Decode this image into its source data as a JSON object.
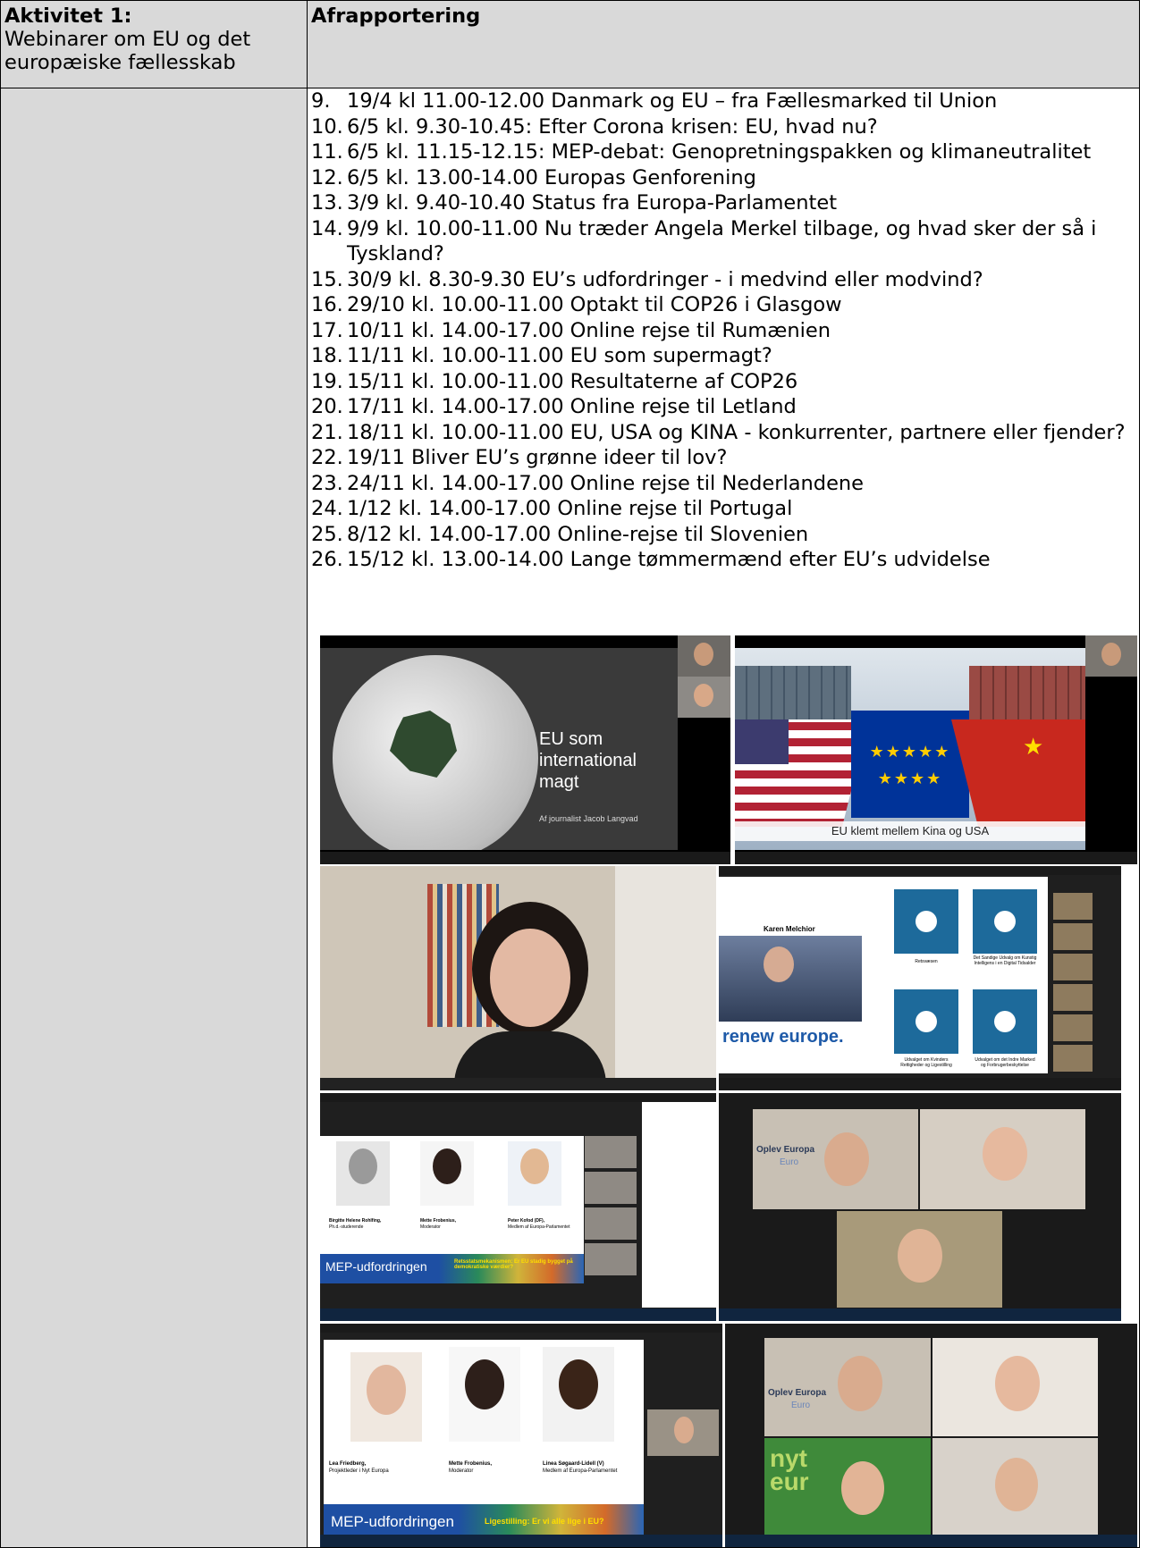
{
  "header": {
    "left_title": "Aktivitet 1:",
    "left_subtitle": "Webinarer om EU og det europæiske fællesskab",
    "right_title": "Afrapportering"
  },
  "events": [
    {
      "num": "9.",
      "text": "19/4 kl 11.00-12.00 Danmark og EU – fra Fællesmarked til Union"
    },
    {
      "num": "10.",
      "text": "6/5 kl. 9.30-10.45: Efter Corona krisen: EU, hvad nu?"
    },
    {
      "num": "11.",
      "text": "6/5 kl. 11.15-12.15: MEP-debat: Genopretningspakken og klimaneutralitet"
    },
    {
      "num": "12.",
      "text": "6/5 kl. 13.00-14.00 Europas Genforening"
    },
    {
      "num": "13.",
      "text": "3/9 kl. 9.40-10.40 Status fra Europa-Parlamentet"
    },
    {
      "num": "14.",
      "text": "9/9 kl. 10.00-11.00 Nu træder Angela Merkel tilbage, og hvad sker der så i Tyskland?"
    },
    {
      "num": "15.",
      "text": "30/9 kl. 8.30-9.30 EU’s udfordringer - i medvind eller modvind?"
    },
    {
      "num": "16.",
      "text": "29/10 kl. 10.00-11.00 Optakt til COP26 i Glasgow"
    },
    {
      "num": "17.",
      "text": "10/11 kl. 14.00-17.00 Online rejse til Rumænien"
    },
    {
      "num": "18.",
      "text": "11/11 kl. 10.00-11.00 EU som supermagt?"
    },
    {
      "num": "19.",
      "text": "15/11 kl. 10.00-11.00 Resultaterne af COP26"
    },
    {
      "num": "20.",
      "text": "17/11 kl. 14.00-17.00 Online rejse til Letland"
    },
    {
      "num": "21.",
      "text": "18/11 kl. 10.00-11.00 EU, USA og KINA - konkurrenter, partnere eller fjender?"
    },
    {
      "num": "22.",
      "text": "19/11 Bliver EU’s grønne ideer til lov?"
    },
    {
      "num": "23.",
      "text": "24/11 kl. 14.00-17.00 Online rejse til Nederlandene"
    },
    {
      "num": "24.",
      "text": "1/12 kl. 14.00-17.00 Online rejse til Portugal"
    },
    {
      "num": "25.",
      "text": "8/12 kl. 14.00-17.00 Online-rejse til Slovenien"
    },
    {
      "num": "26.",
      "text": "15/12 kl. 13.00-14.00 Lange tømmermænd efter EU’s udvidelse"
    }
  ],
  "screenshots": {
    "s1": {
      "title_l1": "EU som",
      "title_l2": "international",
      "title_l3": "magt",
      "byline": "Af journalist Jacob Langvad"
    },
    "s2": {
      "caption": "EU klemt mellem Kina og USA"
    },
    "s4": {
      "speaker": "Karen Melchior",
      "brand": "renew europe.",
      "box1": "Retsvæsen",
      "box2": "Det Sandige Udvalg om Kunstig Intelligens i en Digital Tidsalder",
      "box3": "Udvalget om Kvinders Rettigheder og Ligestilling",
      "box4": "Udvalget om det Indre Marked og Forbrugerbeskyttelse"
    },
    "s5": {
      "p1": "Birgitte Helene Rohlfing,",
      "p1r": "Ph.d.-studerende",
      "p2": "Mette Frobenius,",
      "p2r": "Moderator",
      "p3": "Peter Kofod (DF),",
      "p3r": "Medlem af Europa-Parlamentet",
      "banner": "MEP-udfordringen",
      "topic": "Retsstatsmekanismen: Er EU stadig bygget på demokratiske værdier?"
    },
    "s6": {
      "banner": "Oplev Europa",
      "sub": "Euro"
    },
    "s7": {
      "p1": "Lea Friedberg,",
      "p1r": "Projektleder i Nyt Europa",
      "p2": "Mette Frobenius,",
      "p2r": "Moderator",
      "p3": "Linea Søgaard-Lidell (V)",
      "p3r": "Medlem af Europa-Parlamentet",
      "banner": "MEP-udfordringen",
      "topic": "Ligestilling: Er vi alle lige i EU?"
    },
    "s8": {
      "banner": "Oplev Europa",
      "sub": "Euro",
      "logo": "nyt eur"
    }
  },
  "colors": {
    "header_bg": "#d9d9d9",
    "zoom_dark": "#1a1a1a",
    "eu_blue": "#003399",
    "eu_star": "#ffcc00",
    "renew_blue": "#1e5aa8",
    "renew_tile": "#1d6a9b",
    "mep_blue": "#1e4fa3"
  }
}
